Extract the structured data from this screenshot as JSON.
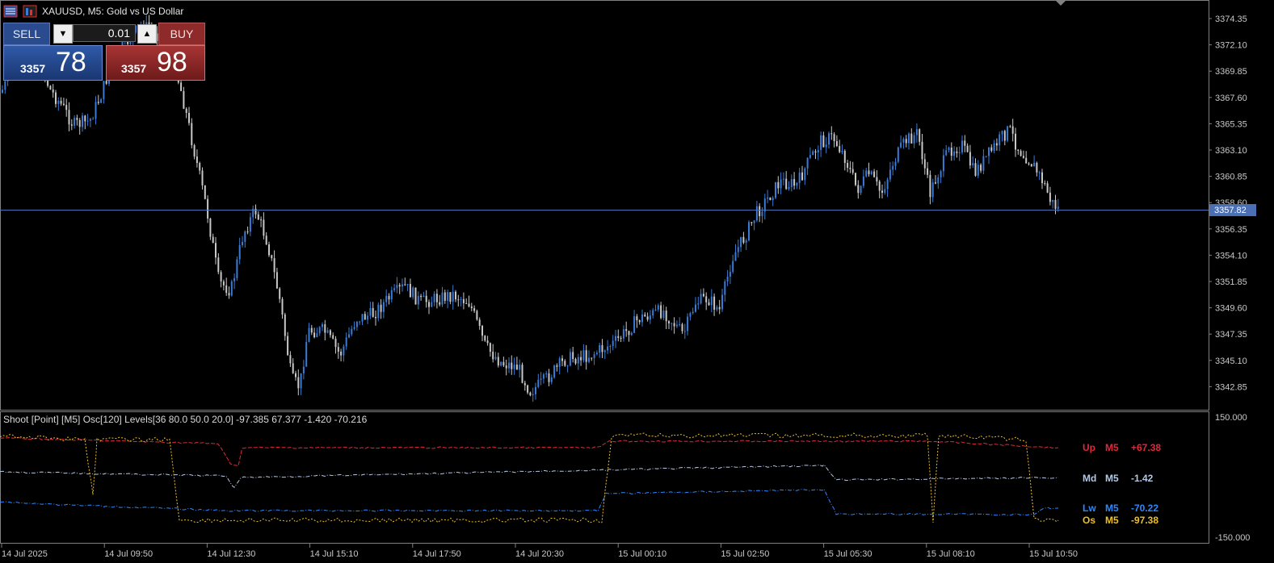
{
  "window": {
    "title": "XAUUSD, M5:  Gold vs US Dollar"
  },
  "trade_panel": {
    "sell_label": "SELL",
    "buy_label": "BUY",
    "lot_value": "0.01",
    "bid": {
      "small": "3357",
      "big": "78"
    },
    "ask": {
      "small": "3357",
      "big": "98"
    }
  },
  "price_axis": {
    "labels": [
      "3374.35",
      "3372.10",
      "3369.85",
      "3367.60",
      "3365.35",
      "3363.10",
      "3360.85",
      "3358.60",
      "3356.35",
      "3354.10",
      "3351.85",
      "3349.60",
      "3347.35",
      "3345.10",
      "3342.85"
    ],
    "current_price": "3357.82"
  },
  "time_axis": {
    "labels": [
      "14 Jul 2025",
      "14 Jul 09:50",
      "14 Jul 12:30",
      "14 Jul 15:10",
      "14 Jul 17:50",
      "14 Jul 20:30",
      "15 Jul 00:10",
      "15 Jul 02:50",
      "15 Jul 05:30",
      "15 Jul 08:10",
      "15 Jul 10:50"
    ]
  },
  "indicator": {
    "label": "Shoot [Point] [M5]  Osc[120]  Levels[36 80.0 50.0 20.0] -97.385 67.377 -1.420 -70.216",
    "axis_max": "150.000",
    "axis_min": "-150.000",
    "legend": [
      {
        "name": "Up",
        "tf": "M5",
        "value": "+67.38",
        "color": "#e0283c"
      },
      {
        "name": "Md",
        "tf": "M5",
        "value": "-1.42",
        "color": "#b4c8e6"
      },
      {
        "name": "Lw",
        "tf": "M5",
        "value": "-70.22",
        "color": "#2c88ff"
      },
      {
        "name": "Os",
        "tf": "M5",
        "value": "-97.38",
        "color": "#f0c020"
      }
    ]
  },
  "colors": {
    "bull": "#3a7bd5",
    "bear": "#c8c8c8",
    "price_line": "#4a6fb5",
    "frame": "#808080"
  }
}
